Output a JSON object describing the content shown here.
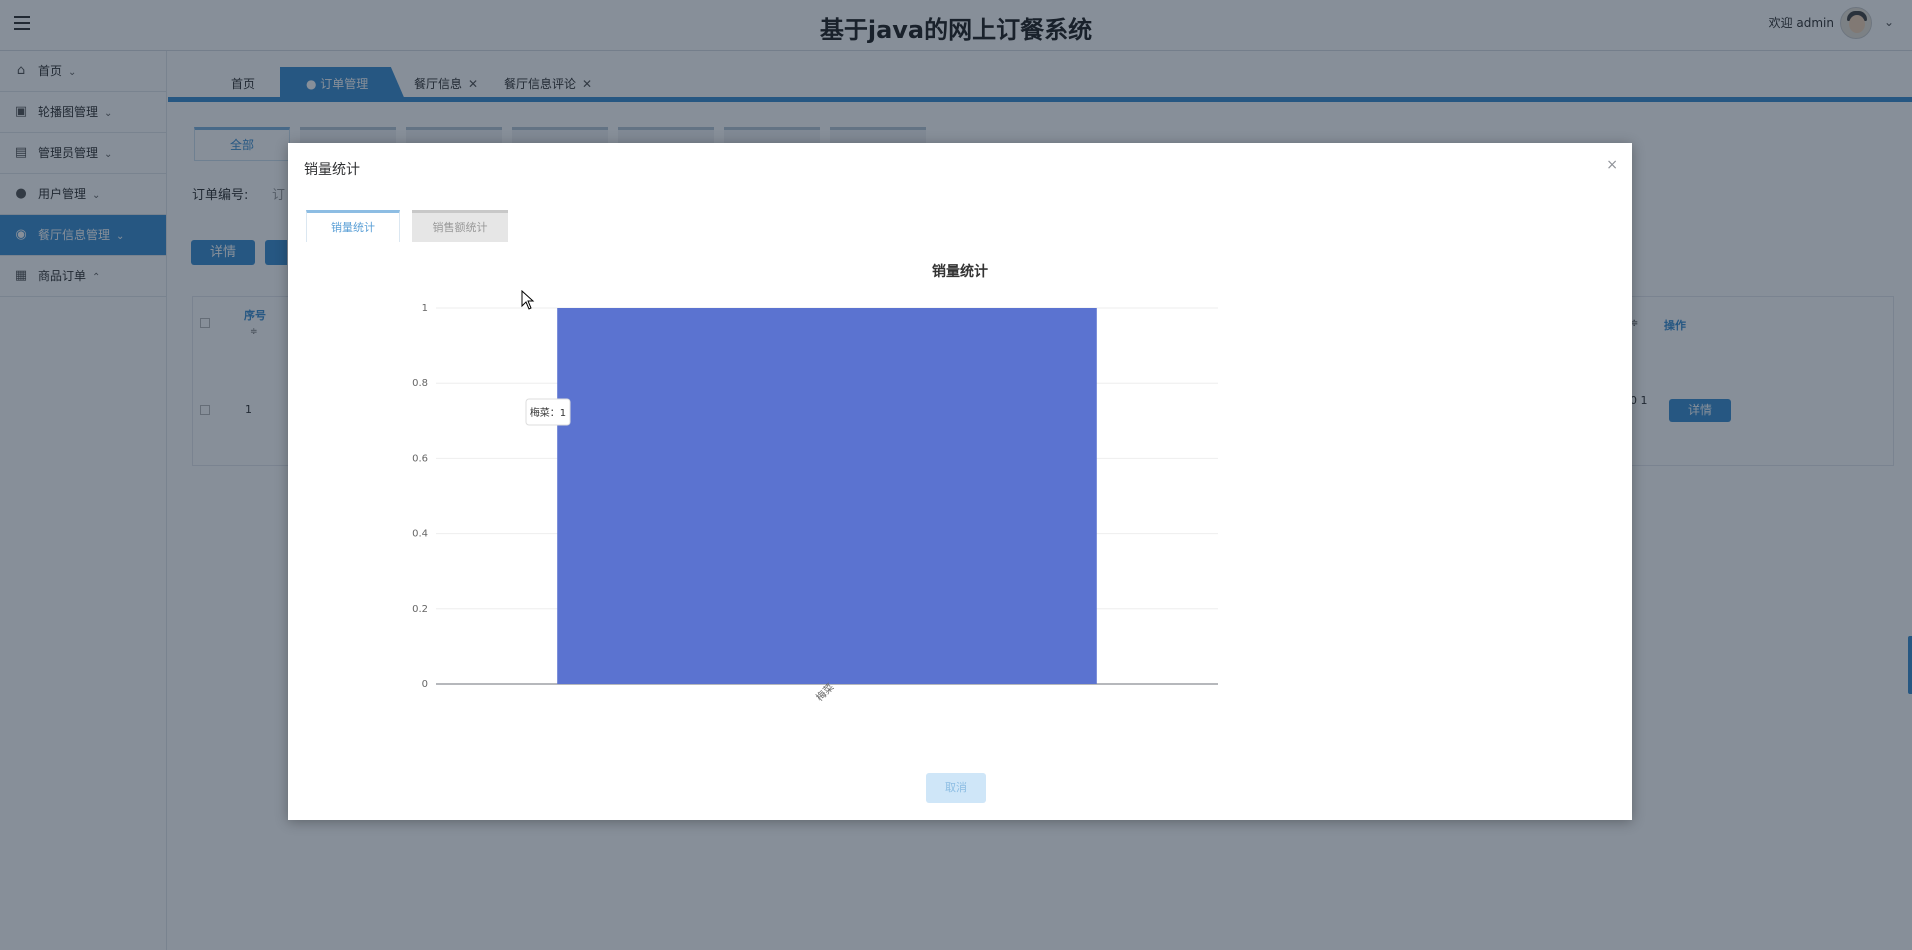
{
  "header": {
    "title": "基于java的网上订餐系统",
    "welcome": "欢迎 admin"
  },
  "sidebar": {
    "items": [
      {
        "label": "首页",
        "icon": "home-icon",
        "caret": "⌄"
      },
      {
        "label": "轮播图管理",
        "icon": "briefcase-icon",
        "caret": "⌄"
      },
      {
        "label": "管理员管理",
        "icon": "server-icon",
        "caret": "⌄"
      },
      {
        "label": "用户管理",
        "icon": "badge-icon",
        "caret": "⌄"
      },
      {
        "label": "餐厅信息管理",
        "icon": "circle-check-icon",
        "caret": "⌄"
      },
      {
        "label": "商品订单",
        "icon": "table-icon",
        "caret": "⌃"
      }
    ]
  },
  "page_tabs": [
    {
      "label": "首页",
      "closable": false
    },
    {
      "label": "● 订单管理",
      "closable": true
    },
    {
      "label": "餐厅信息",
      "closable": true
    },
    {
      "label": "餐厅信息评论",
      "closable": true
    }
  ],
  "background": {
    "filter_tab_first": "全部",
    "order_no_label": "订单编号:",
    "order_no_input": "订",
    "detail_btn": "详情",
    "col_seq": "序号",
    "col_op": "操作",
    "row_seq": "1",
    "row_trunc": "0 1",
    "row_detail_btn": "详情",
    "sort_glyph": "≑"
  },
  "modal": {
    "title": "销量统计",
    "close": "×",
    "tab_active": "销量统计",
    "tab_inactive": "销售额统计",
    "cancel": "取消"
  },
  "colors": {
    "accent": "#3d8fd1",
    "bar": "#5b73d0"
  },
  "chart_data": {
    "type": "bar",
    "title": "销量统计",
    "categories": [
      "梅菜"
    ],
    "values": [
      1
    ],
    "ylim": [
      0,
      1
    ],
    "yticks": [
      "0",
      "0.2",
      "0.4",
      "0.6",
      "0.8",
      "1"
    ],
    "grid": true,
    "tooltip": "梅菜：1"
  }
}
